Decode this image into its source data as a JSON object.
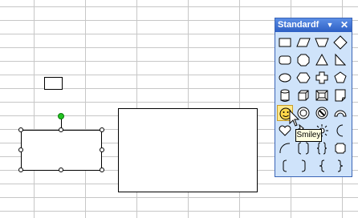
{
  "palette": {
    "title": "Standardf",
    "menu_icon": "dropdown-triangle-icon",
    "close_icon": "close-icon",
    "shapes": [
      "rectangle",
      "parallelogram",
      "trapezoid",
      "diamond",
      "rounded-rectangle",
      "octagon",
      "triangle",
      "right-triangle",
      "oval",
      "hexagon",
      "cross",
      "pentagon",
      "can",
      "cube",
      "bevel",
      "folded-corner",
      "smiley",
      "donut",
      "no-symbol",
      "block-arc",
      "heart",
      "lightning-bolt",
      "sun",
      "moon",
      "arc",
      "double-bracket",
      "double-brace",
      "plaque",
      "left-bracket",
      "right-bracket",
      "left-brace",
      "right-brace"
    ],
    "active_shape": "smiley"
  },
  "tooltip": {
    "text": "Smiley"
  },
  "colors": {
    "palette_bg": "#cfe3fa",
    "title_bar": "#2d5fc4",
    "rotation_handle": "#22c322",
    "active_cell": "#ffe88a"
  }
}
